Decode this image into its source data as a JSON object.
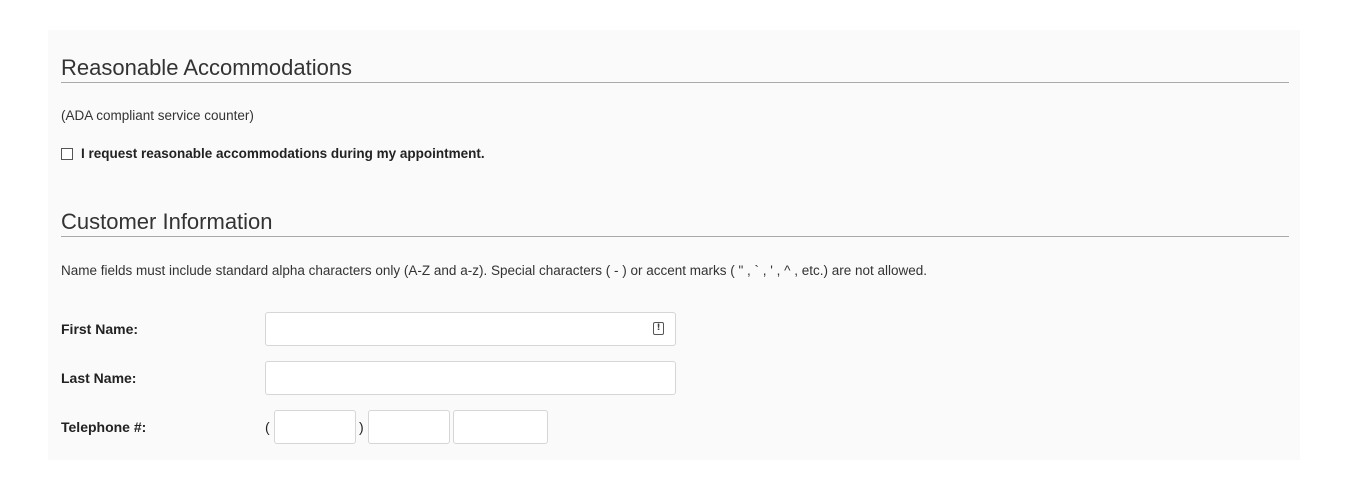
{
  "accommodations": {
    "title": "Reasonable Accommodations",
    "note": "(ADA compliant service counter)",
    "checkbox_label": "I request reasonable accommodations during my appointment.",
    "checked": false
  },
  "customer_info": {
    "title": "Customer Information",
    "note": "Name fields must include standard alpha characters only (A-Z and a-z). Special characters ( - ) or accent marks ( \" , ` , ' , ^ , etc.) are not allowed.",
    "first_name_label": "First Name:",
    "first_name_value": "",
    "last_name_label": "Last Name:",
    "last_name_value": "",
    "phone_label": "Telephone #:",
    "phone_open_paren": "(",
    "phone_close_paren": ")",
    "phone_area_value": "",
    "phone_prefix_value": "",
    "phone_line_value": ""
  },
  "icons": {
    "first_name_field_icon": "autofill-warning-icon"
  },
  "colors": {
    "panel_background": "#fafafa",
    "divider": "#aaaaaa",
    "input_border": "#d6d6d6"
  }
}
